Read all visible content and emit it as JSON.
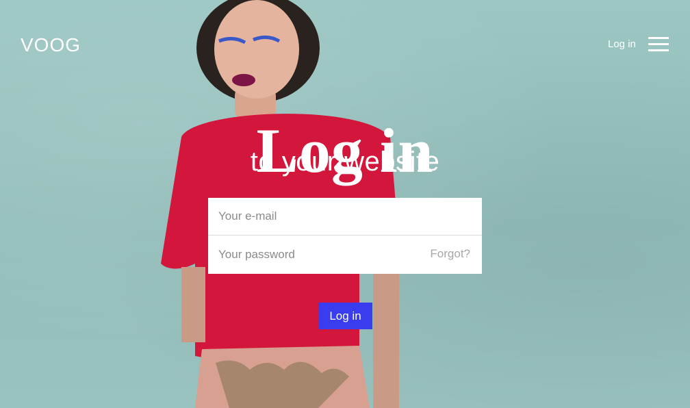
{
  "header": {
    "logo_text": "VOOG",
    "login_link": "Log in",
    "menu_icon": "hamburger-menu-icon"
  },
  "hero": {
    "title": "Log in",
    "subtitle": "to your website"
  },
  "form": {
    "email_placeholder": "Your e-mail",
    "email_value": "",
    "password_placeholder": "Your password",
    "password_value": "",
    "forgot_label": "Forgot?",
    "submit_label": "Log in"
  },
  "colors": {
    "background": "#98c0bd",
    "accent": "#3a3cf0",
    "text_on_bg": "#ffffff",
    "placeholder": "#8a8a8a",
    "forgot": "#a7a7a7"
  }
}
